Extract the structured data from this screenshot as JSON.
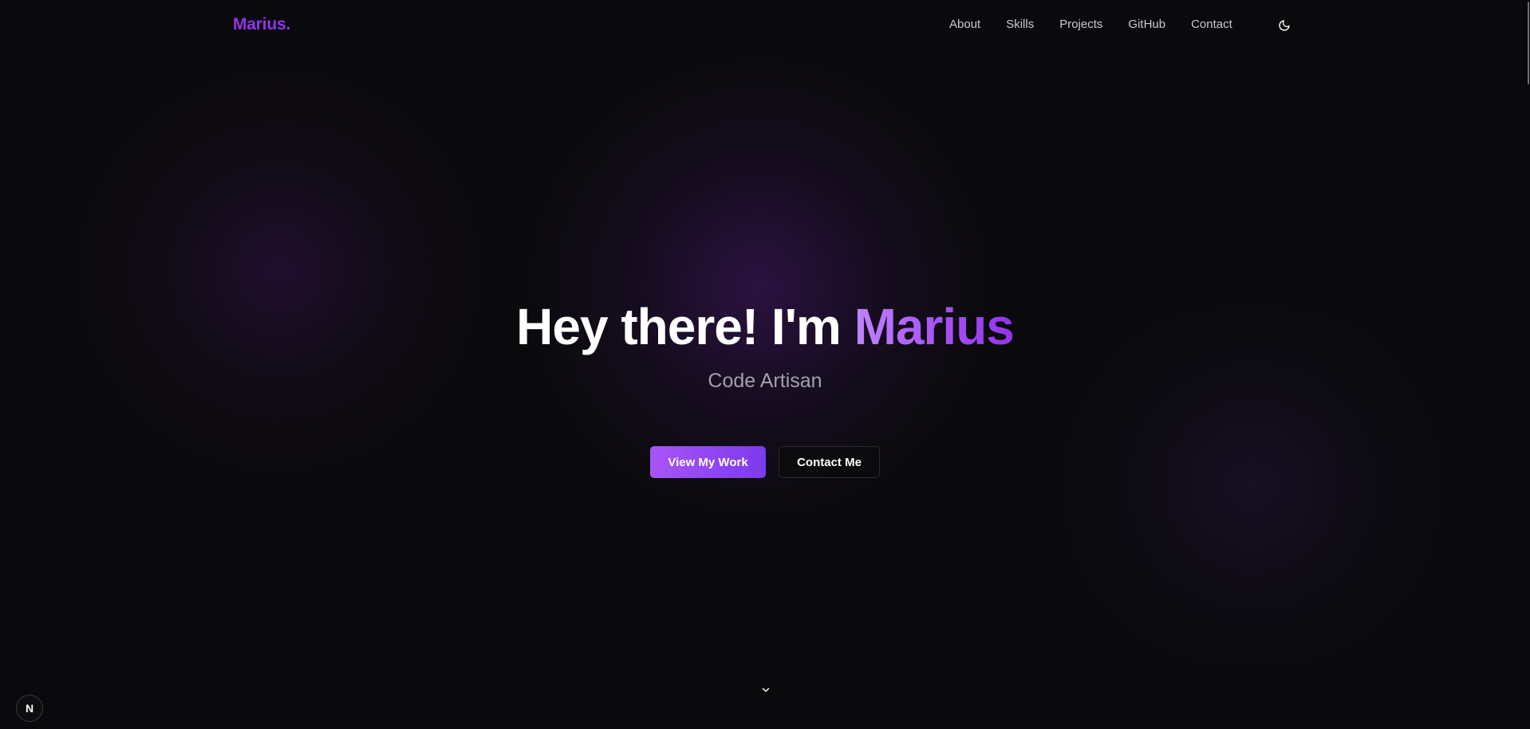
{
  "navbar": {
    "logo": "Marius.",
    "links": [
      "About",
      "Skills",
      "Projects",
      "GitHub",
      "Contact"
    ],
    "theme_icon": "moon-icon"
  },
  "hero": {
    "title_prefix": "Hey there! I'm ",
    "title_name": "Marius",
    "subtitle": "Code Artisan",
    "primary_button": "View My Work",
    "secondary_button": "Contact Me",
    "scroll_icon": "chevron-down-icon"
  },
  "badge": {
    "letter": "N",
    "icon": "nextjs-logo-icon"
  },
  "colors": {
    "accent": "#9333ea",
    "accent_light": "#c084fc",
    "background": "#0a0a0c",
    "text_muted": "#a1a1aa"
  }
}
